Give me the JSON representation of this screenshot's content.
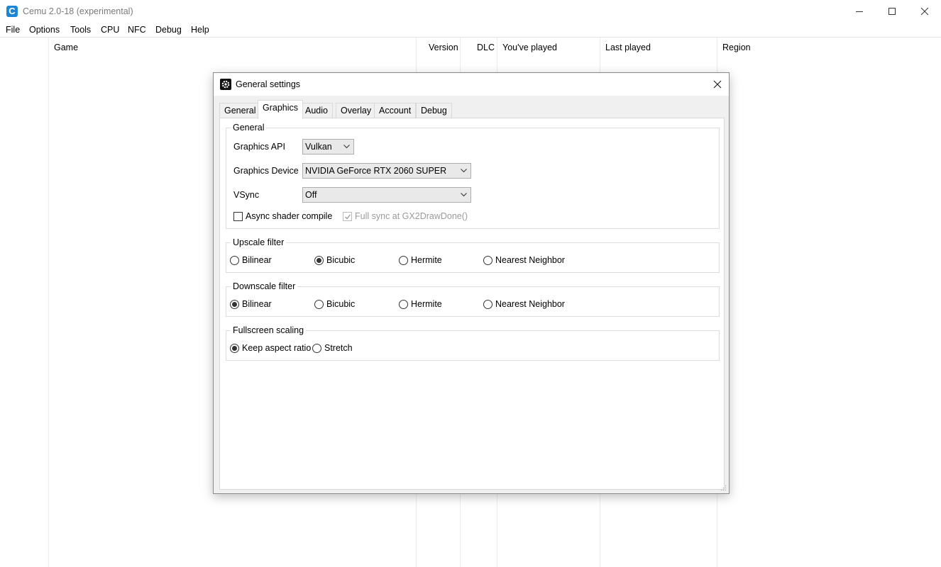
{
  "app": {
    "title": "Cemu 2.0-18 (experimental)",
    "icon_letter": "C",
    "window_controls": [
      "minimize-icon",
      "maximize-icon",
      "close-icon"
    ]
  },
  "menu": [
    "File",
    "Options",
    "Tools",
    "CPU",
    "NFC",
    "Debug",
    "Help"
  ],
  "game_list": {
    "columns": [
      "Game",
      "Version",
      "DLC",
      "You've played",
      "Last played",
      "Region"
    ]
  },
  "dialog": {
    "title": "General settings",
    "icon": "gear-icon",
    "tabs": [
      "General",
      "Graphics",
      "Audio",
      "Overlay",
      "Account",
      "Debug"
    ],
    "active_tab": "Graphics",
    "general_group": {
      "title": "General",
      "graphics_api_label": "Graphics API",
      "graphics_api_value": "Vulkan",
      "graphics_device_label": "Graphics Device",
      "graphics_device_value": "NVIDIA GeForce RTX 2060 SUPER",
      "vsync_label": "VSync",
      "vsync_value": "Off",
      "async_shader_label": "Async shader compile",
      "async_shader_checked": false,
      "full_sync_label": "Full sync at GX2DrawDone()",
      "full_sync_checked": true,
      "full_sync_disabled": true
    },
    "upscale_group": {
      "title": "Upscale filter",
      "options": [
        "Bilinear",
        "Bicubic",
        "Hermite",
        "Nearest Neighbor"
      ],
      "selected": "Bicubic"
    },
    "downscale_group": {
      "title": "Downscale filter",
      "options": [
        "Bilinear",
        "Bicubic",
        "Hermite",
        "Nearest Neighbor"
      ],
      "selected": "Bilinear"
    },
    "fullscreen_group": {
      "title": "Fullscreen scaling",
      "options": [
        "Keep aspect ratio",
        "Stretch"
      ],
      "selected": "Keep aspect ratio"
    }
  }
}
